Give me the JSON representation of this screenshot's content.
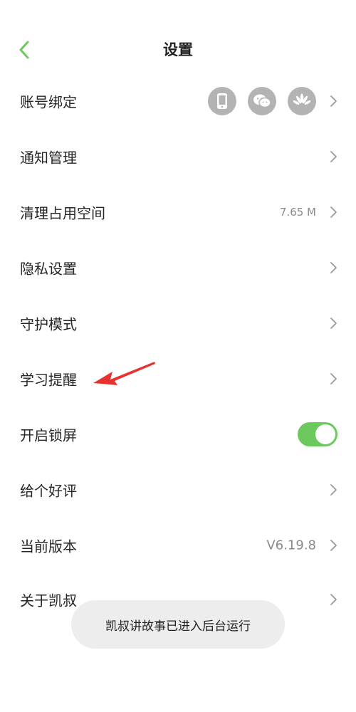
{
  "header": {
    "title": "设置",
    "back_icon": "chevron-left-icon",
    "accent": "#6cc95e"
  },
  "rows": [
    {
      "label": "账号绑定",
      "icons": [
        "phone-icon",
        "wechat-icon",
        "huawei-icon"
      ]
    },
    {
      "label": "通知管理"
    },
    {
      "label": "清理占用空间",
      "value": "7.65 M"
    },
    {
      "label": "隐私设置"
    },
    {
      "label": "守护模式"
    },
    {
      "label": "学习提醒"
    },
    {
      "label": "开启锁屏",
      "toggle_on": true
    },
    {
      "label": "给个好评"
    },
    {
      "label": "当前版本",
      "value": "V6.19.8"
    },
    {
      "label": "关于凯叔"
    }
  ],
  "toast": {
    "text": "凯叔讲故事已进入后台运行"
  },
  "annotation": {
    "type": "red-arrow",
    "color": "#e8322f"
  }
}
